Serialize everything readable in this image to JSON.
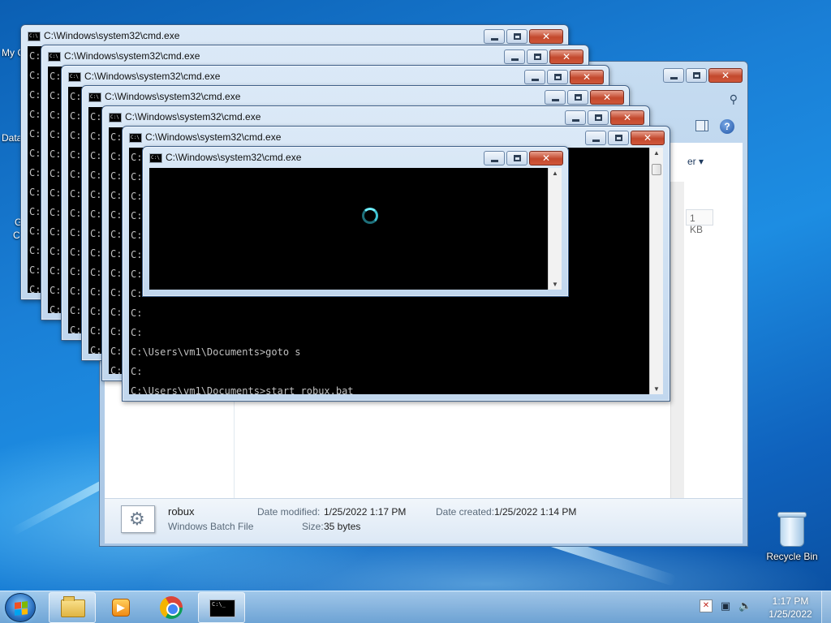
{
  "desktop": {
    "recycle_bin_label": "Recycle Bin",
    "partial_icon_labels": [
      "My C",
      "Data",
      "G",
      "C"
    ]
  },
  "explorer": {
    "organize_fragment": "er ▾",
    "size_fragment": "1 KB",
    "details": {
      "file_name": "robux",
      "file_type": "Windows Batch File",
      "date_modified_label": "Date modified:",
      "date_modified_value": "1/25/2022 1:17 PM",
      "date_created_label": "Date created:",
      "date_created_value": "1/25/2022 1:14 PM",
      "size_label": "Size:",
      "size_value": "35 bytes"
    }
  },
  "cmd_windows": [
    {
      "title": "C:\\Windows\\system32\\cmd.exe",
      "lines": [
        "C:",
        "C:\\Us",
        "C:\\Us",
        "C:\\Us",
        "C:",
        "C:",
        "C:",
        "C:",
        "C:",
        "C:",
        "C:",
        "C:",
        "C:"
      ]
    },
    {
      "title": "C:\\Windows\\system32\\cmd.exe",
      "lines": [
        "C:",
        "C:\\Us",
        "C:\\Us",
        "C:\\Us",
        "C:",
        "C:",
        "C:",
        "C:",
        "C:",
        "C:",
        "C:",
        "C:",
        "C:"
      ]
    },
    {
      "title": "C:\\Windows\\system32\\cmd.exe",
      "lines": [
        "C:",
        "C:\\Us",
        "C:\\Us",
        "C:\\Us",
        "C:",
        "C:",
        "C:",
        "C:",
        "C:",
        "C:",
        "C:",
        "C:",
        "C:"
      ]
    },
    {
      "title": "C:\\Windows\\system32\\cmd.exe",
      "lines": [
        "C:",
        "C:\\Users\\vm1\\Doc",
        "C:",
        "C:",
        "C:",
        "C:",
        "C:",
        "C:",
        "C:",
        "C:",
        "C:",
        "C:",
        "C:"
      ]
    },
    {
      "title": "C:\\Windows\\system32\\cmd.exe",
      "lines": [
        "C:",
        "C:",
        "C:",
        "C:",
        "C:",
        "C:",
        "C:",
        "C:",
        "C:",
        "C:",
        "C:",
        "C:\\Users\\vm1\\Documents>start robux.bat",
        "C:"
      ]
    },
    {
      "title": "C:\\Windows\\system32\\cmd.exe",
      "lines": [
        "C:",
        "C:",
        "C:",
        "C:",
        "C:",
        "C:",
        "C:",
        "C:",
        "C:",
        "C:",
        "C:\\Users\\vm1\\Documents>goto s",
        "C:",
        "C:\\Users\\vm1\\Documents>start robux.bat"
      ]
    },
    {
      "title": "C:\\Windows\\system32\\cmd.exe",
      "lines": []
    }
  ],
  "taskbar": {
    "clock_time": "1:17 PM",
    "clock_date": "1/25/2022"
  }
}
